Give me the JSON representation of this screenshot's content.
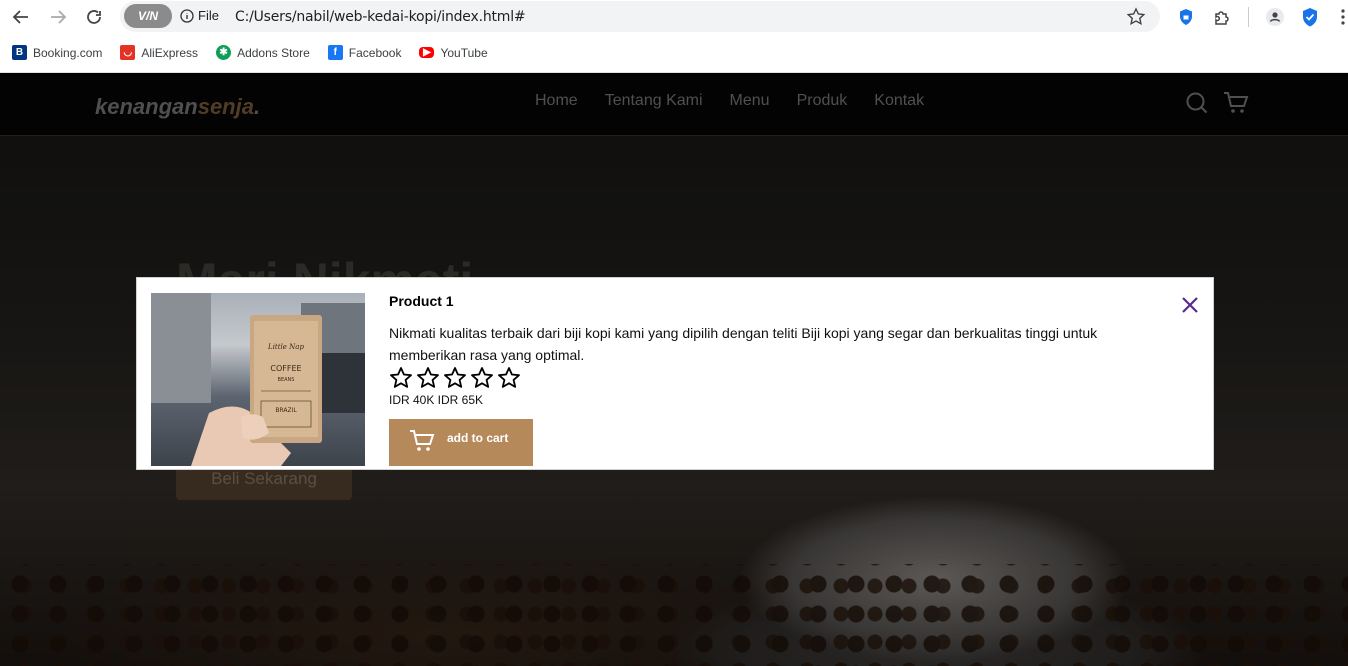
{
  "browser": {
    "vpn_label": "V/N",
    "site_info_label": "File",
    "url": "C:/Users/nabil/web-kedai-kopi/index.html#",
    "bookmarks": [
      {
        "label": "Booking.com",
        "icon": "booking-icon",
        "color": "#003580"
      },
      {
        "label": "AliExpress",
        "icon": "aliexpress-icon",
        "color": "#e43225"
      },
      {
        "label": "Addons Store",
        "icon": "addons-store-icon",
        "color": "#0f9d58"
      },
      {
        "label": "Facebook",
        "icon": "facebook-icon",
        "color": "#1877f2"
      },
      {
        "label": "YouTube",
        "icon": "youtube-icon",
        "color": "#ff0000"
      }
    ]
  },
  "site": {
    "logo_main": "kenangan",
    "logo_accent": "senja",
    "logo_dot": ".",
    "nav": [
      "Home",
      "Tentang Kami",
      "Menu",
      "Produk",
      "Kontak"
    ],
    "hero_title": "Mari Nikmati",
    "cta_label": "Beli Sekarang"
  },
  "modal": {
    "title": "Product 1",
    "description": "Nikmati kualitas terbaik dari biji kopi kami yang dipilih dengan teliti Biji kopi yang segar dan berkualitas tinggi untuk memberikan rasa yang optimal.",
    "rating_filled": 0,
    "rating_max": 5,
    "price": "IDR 40K IDR 65K",
    "add_to_cart_label": "add to cart",
    "image_bag_text": [
      "Little Nap",
      "COFFEE",
      "BEANS",
      "BRAZIL"
    ],
    "accent_color": "#b6895b",
    "close_color": "#5b2a86"
  }
}
